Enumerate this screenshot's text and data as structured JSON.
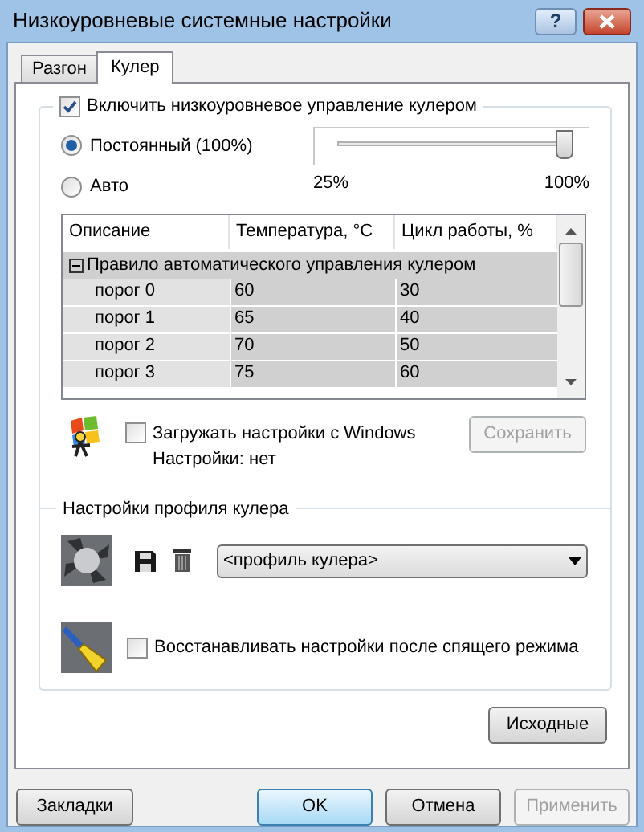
{
  "window": {
    "title": "Низкоуровневые системные настройки",
    "help_button": "?"
  },
  "tabs": [
    {
      "label": "Разгон",
      "selected": false
    },
    {
      "label": "Кулер",
      "selected": true
    }
  ],
  "cooler": {
    "enable": {
      "label": "Включить низкоуровневое управление кулером",
      "checked": true
    },
    "modes": [
      {
        "label": "Постоянный (100%)",
        "selected": true
      },
      {
        "label": "Авто",
        "selected": false
      }
    ],
    "slider": {
      "level": 1,
      "min_label": "25%",
      "max_label": "100%"
    },
    "table": {
      "columns": [
        "Описание",
        "Температура, °C",
        "Цикл работы, %"
      ],
      "group": {
        "label": "Правило автоматического управления кулером",
        "expanded": true
      },
      "rows": [
        [
          "порог 0",
          "60",
          "30"
        ],
        [
          "порог 1",
          "65",
          "40"
        ],
        [
          "порог 2",
          "70",
          "50"
        ],
        [
          "порог 3",
          "75",
          "60"
        ]
      ]
    },
    "load_from_windows": {
      "label": "Загружать настройки с Windows",
      "checked": false,
      "status": "Настройки:  нет"
    },
    "save_button": {
      "label": "Сохранить",
      "disabled": true
    },
    "profile": {
      "title": "Настройки профиля кулера",
      "dropdown": "<профиль кулера>"
    },
    "restore": {
      "label": "Восстанавливать настройки после спящего режима",
      "checked": false
    }
  },
  "defaults_button": "Исходные",
  "buttons": [
    {
      "label": "Закладки",
      "kind": "left",
      "disabled": false
    },
    {
      "label": "OK",
      "kind": "default",
      "disabled": false
    },
    {
      "label": "Отмена",
      "kind": "normal",
      "disabled": false
    },
    {
      "label": "Применить",
      "kind": "normal",
      "disabled": true
    }
  ]
}
